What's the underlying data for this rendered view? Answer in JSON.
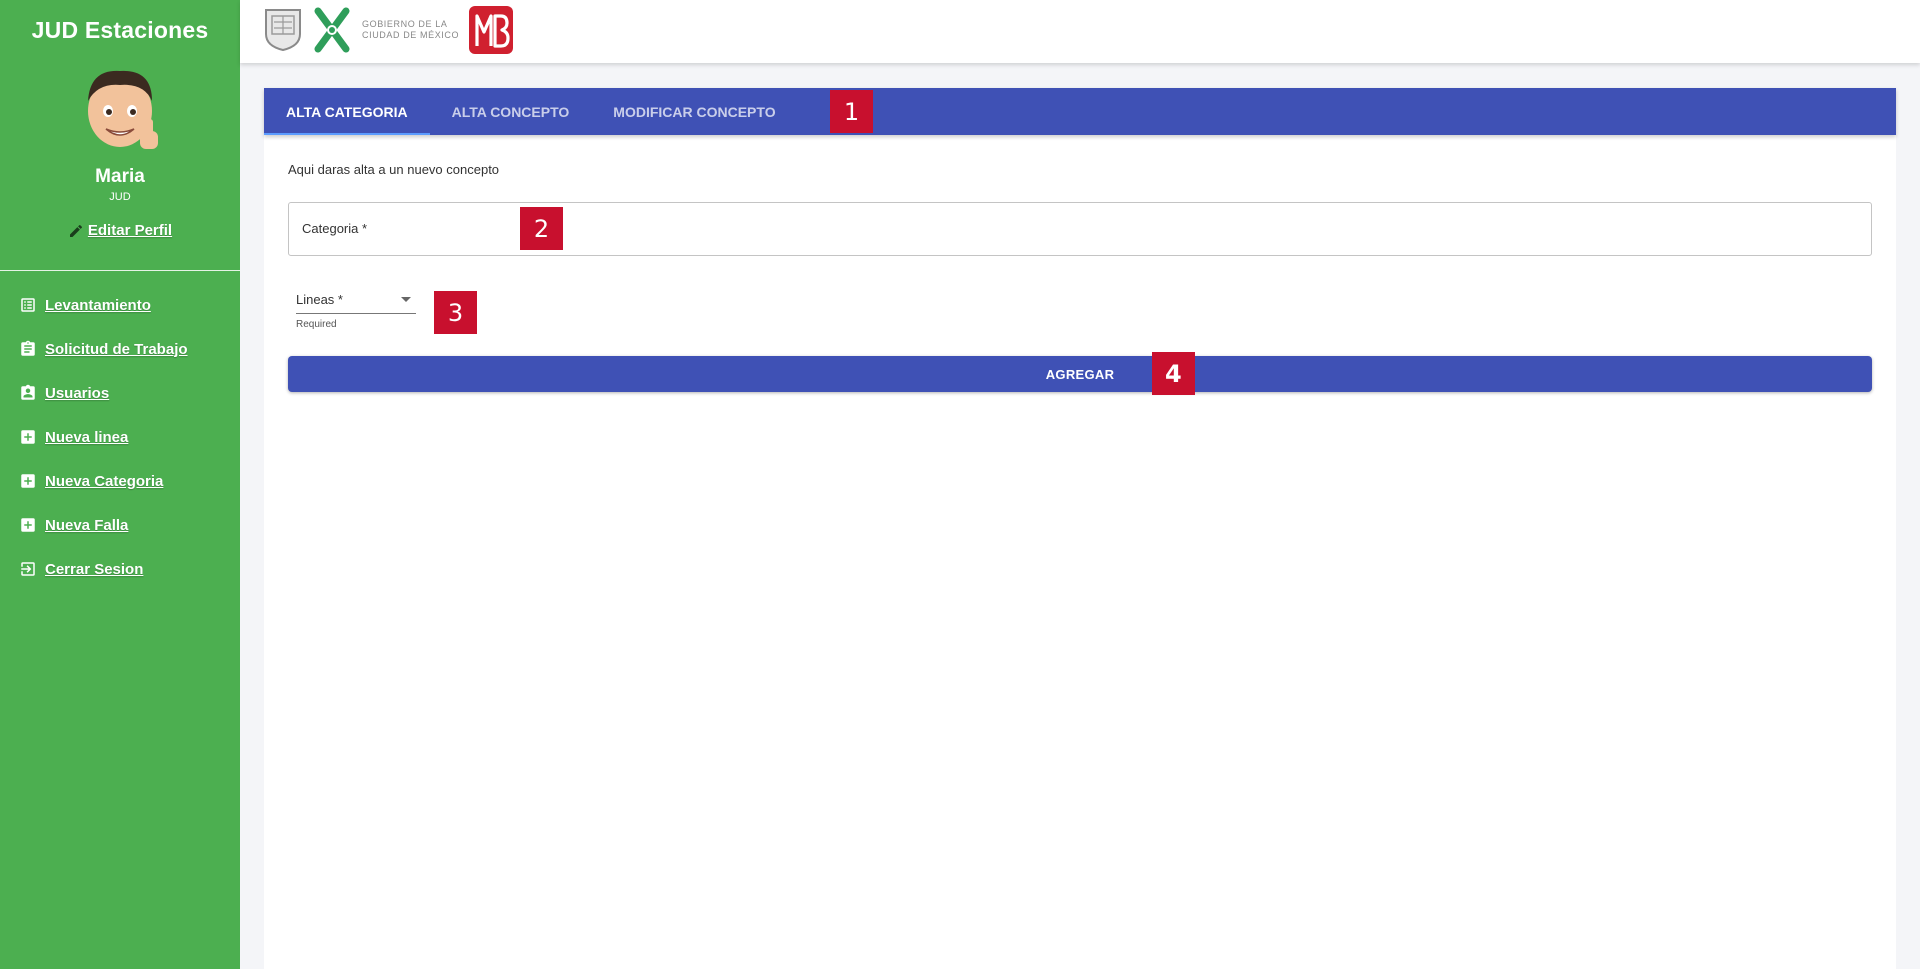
{
  "sidebar": {
    "app_title": "JUD Estaciones",
    "user_name": "Maria",
    "user_role": "JUD",
    "edit_profile": "Editar Perfil",
    "items": [
      {
        "label": "Levantamiento",
        "icon": "list-icon"
      },
      {
        "label": "Solicitud de Trabajo",
        "icon": "clipboard-icon"
      },
      {
        "label": "Usuarios",
        "icon": "user-badge-icon"
      },
      {
        "label": "Nueva linea",
        "icon": "plus-box-icon"
      },
      {
        "label": "Nueva Categoria",
        "icon": "plus-box-icon"
      },
      {
        "label": "Nueva Falla",
        "icon": "plus-box-icon"
      },
      {
        "label": "Cerrar Sesion",
        "icon": "logout-icon"
      }
    ]
  },
  "header": {
    "gov_line1": "GOBIERNO DE LA",
    "gov_line2": "CIUDAD DE MÉXICO"
  },
  "tabs": [
    {
      "label": "ALTA CATEGORIA",
      "active": true
    },
    {
      "label": "ALTA CONCEPTO",
      "active": false
    },
    {
      "label": "MODIFICAR CONCEPTO",
      "active": false
    }
  ],
  "form": {
    "intro": "Aqui daras alta a un nuevo concepto",
    "categoria_placeholder": "Categoria *",
    "lineas_placeholder": "Lineas *",
    "lineas_helper": "Required",
    "submit_label": "AGREGAR"
  },
  "markers": [
    "1",
    "2",
    "3",
    "4"
  ],
  "colors": {
    "sidebar": "#4caf50",
    "primary": "#3f51b5",
    "marker": "#c8102e"
  }
}
